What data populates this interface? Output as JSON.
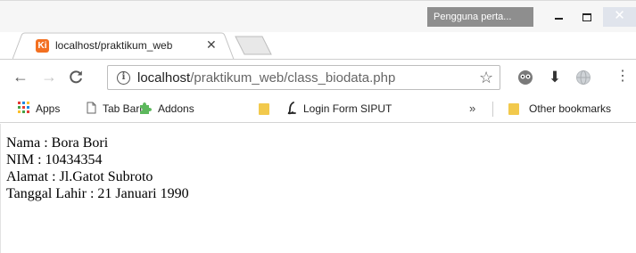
{
  "window": {
    "profile_label": "Pengguna perta...",
    "minimize": "–",
    "close": "✕"
  },
  "tab": {
    "favicon_text": "Ki",
    "title": "localhost/praktikum_web",
    "close": "✕"
  },
  "toolbar": {
    "back": "←",
    "forward": "→",
    "reload": "C",
    "info": "i",
    "url_host": "localhost",
    "url_path": "/praktikum_web/class_biodata.php",
    "star": "☆",
    "download": "⬇",
    "menu": "⋮"
  },
  "bookmarks": {
    "items": [
      {
        "label": "Apps",
        "icon": "apps-grid-icon"
      },
      {
        "label": "Tab Baru",
        "icon": "page-icon"
      },
      {
        "label": "Addons",
        "icon": "puzzle-icon"
      },
      {
        "label": "",
        "icon": "folder-icon"
      },
      {
        "label": "Login Form SIPUT",
        "icon": "script-l-icon"
      }
    ],
    "overflow": "»",
    "other": "Other bookmarks"
  },
  "content": {
    "lines": [
      "Nama : Bora Bori",
      "NIM : 10434354",
      "Alamat : Jl.Gatot Subroto",
      "Tanggal Lahir : 21 Januari 1990"
    ]
  },
  "colors": {
    "accent_favicon": "#f37021",
    "titlebar": "#f6f6f6",
    "profile_pill": "#8e8e8e",
    "folder": "#f2c94c"
  }
}
